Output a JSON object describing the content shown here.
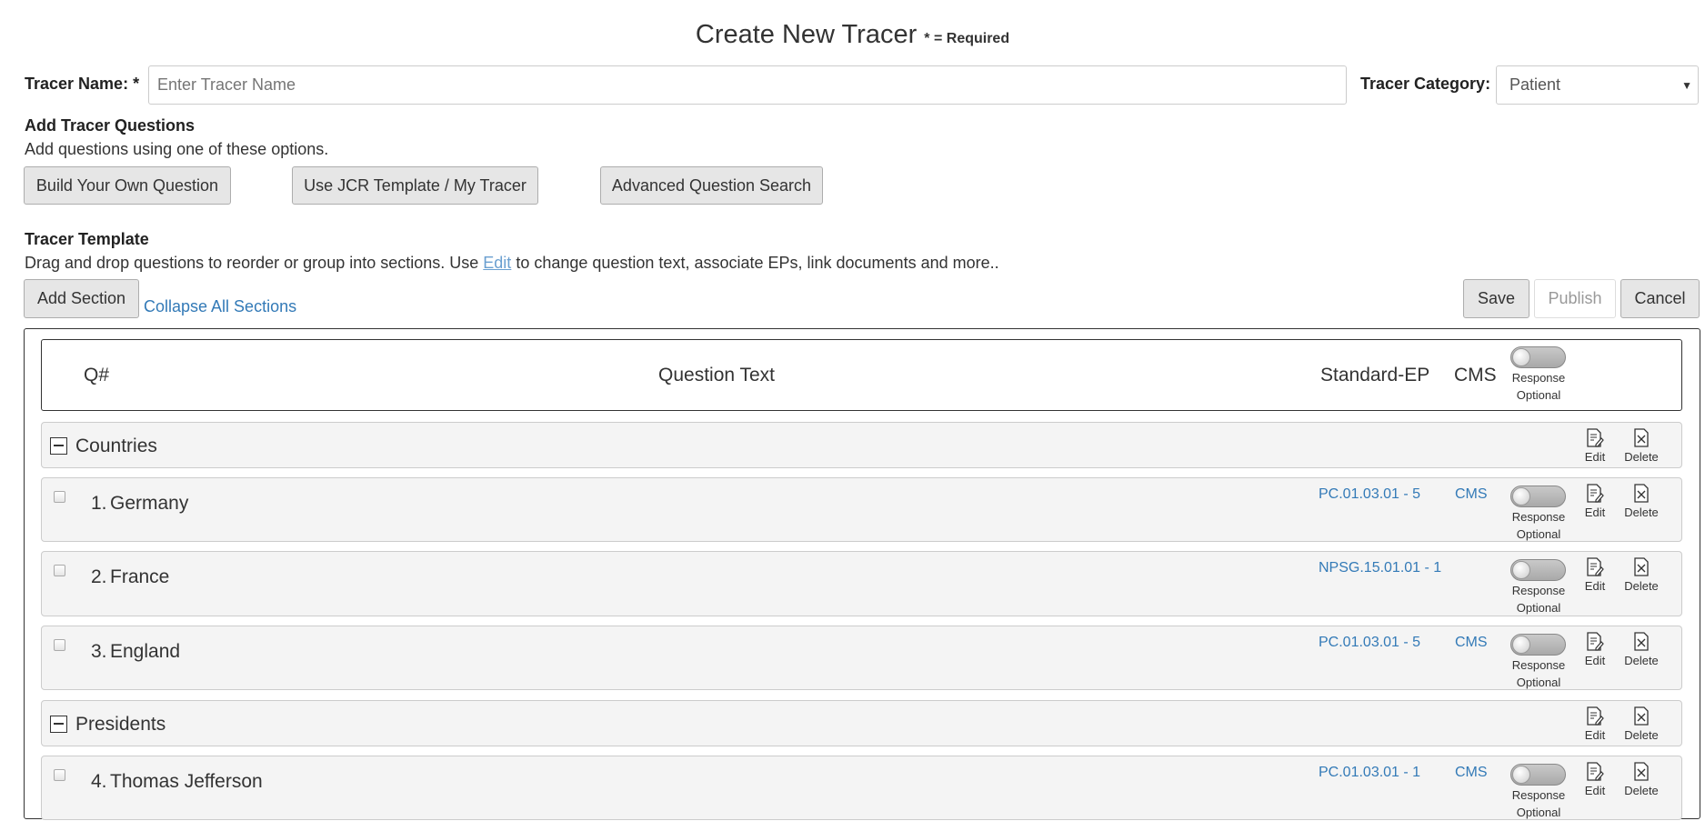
{
  "page": {
    "title": "Create New Tracer",
    "required_note": "* = Required"
  },
  "form": {
    "name_label": "Tracer Name: *",
    "name_placeholder": "Enter Tracer Name",
    "category_label": "Tracer Category:",
    "category_value": "Patient"
  },
  "add_questions": {
    "heading": "Add Tracer Questions",
    "hint": "Add questions using one of these options.",
    "build_button": "Build Your Own Question",
    "template_button": "Use JCR Template / My Tracer",
    "search_button": "Advanced Question Search"
  },
  "template": {
    "heading": "Tracer Template",
    "desc_before": "Drag and drop questions to reorder or group into sections. Use ",
    "desc_link": "Edit",
    "desc_after": " to change question text, associate EPs, link documents and more..",
    "add_section_button": "Add Section",
    "collapse_all_link": "Collapse All Sections",
    "save_button": "Save",
    "publish_button": "Publish",
    "cancel_button": "Cancel"
  },
  "table_header": {
    "q_num": "Q#",
    "question_text": "Question Text",
    "standard_ep": "Standard-EP",
    "cms": "CMS",
    "response_optional": "Response Optional"
  },
  "actions": {
    "edit": "Edit",
    "delete": "Delete",
    "response": "Response",
    "optional": "Optional"
  },
  "sections": [
    {
      "title": "Countries",
      "questions": [
        {
          "num": "1.",
          "text": "Germany",
          "standard": "PC.01.03.01 - 5",
          "cms": "CMS"
        },
        {
          "num": "2.",
          "text": "France",
          "standard": "NPSG.15.01.01 - 1",
          "cms": ""
        },
        {
          "num": "3.",
          "text": "England",
          "standard": "PC.01.03.01 - 5",
          "cms": "CMS"
        }
      ]
    },
    {
      "title": "Presidents",
      "questions": [
        {
          "num": "4.",
          "text": "Thomas Jefferson",
          "standard": "PC.01.03.01 - 1",
          "cms": "CMS"
        }
      ]
    }
  ],
  "colors": {
    "link": "#337ab7",
    "button_bg": "#e6e6e6",
    "row_bg": "#f4f4f4"
  }
}
